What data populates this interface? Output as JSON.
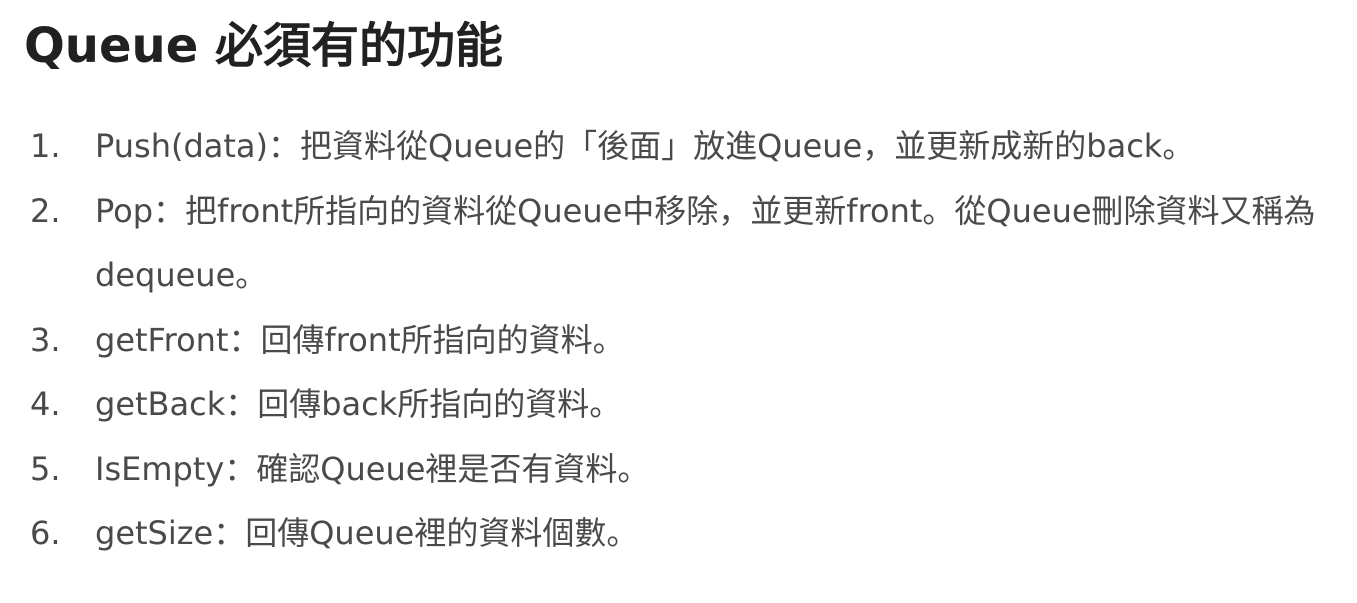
{
  "title": "Queue 必須有的功能",
  "items": [
    {
      "number": "1.",
      "text": "Push(data)：把資料從Queue的「後面」放進Queue，並更新成新的back。"
    },
    {
      "number": "2.",
      "text": "Pop：把front所指向的資料從Queue中移除，並更新front。從Queue刪除資料又稱為dequeue。"
    },
    {
      "number": "3.",
      "text": "getFront：回傳front所指向的資料。"
    },
    {
      "number": "4.",
      "text": "getBack：回傳back所指向的資料。"
    },
    {
      "number": "5.",
      "text": "IsEmpty：確認Queue裡是否有資料。"
    },
    {
      "number": "6.",
      "text": "getSize：回傳Queue裡的資料個數。"
    }
  ]
}
